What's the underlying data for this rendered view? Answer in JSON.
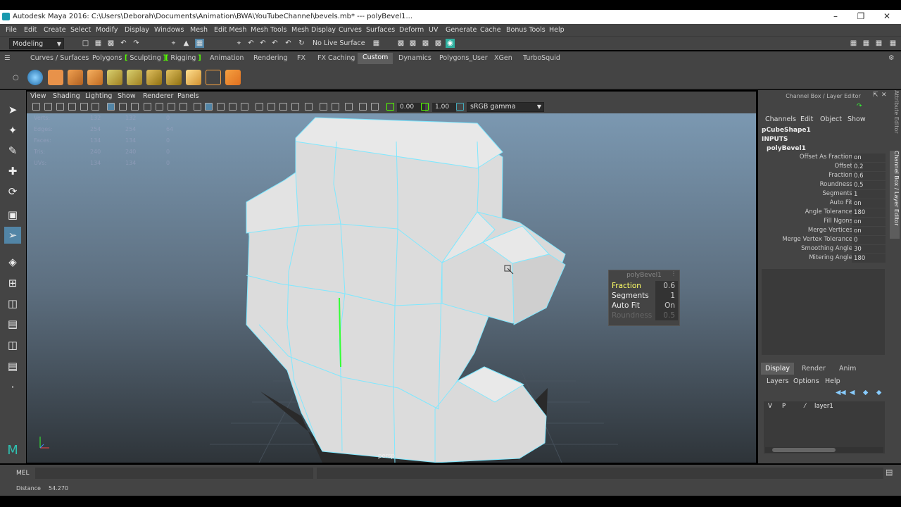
{
  "titlebar": {
    "title": "Autodesk Maya 2016: C:\\Users\\Deborah\\Documents\\Animation\\BWA\\YouTubeChannel\\bevels.mb*   ---   polyBevel1..."
  },
  "menubar": {
    "items": [
      "File",
      "Edit",
      "Create",
      "Select",
      "Modify",
      "Display",
      "Windows",
      "Mesh",
      "Edit Mesh",
      "Mesh Tools",
      "Mesh Display",
      "Curves",
      "Surfaces",
      "Deform",
      "UV",
      "Generate",
      "Cache",
      "Bonus Tools",
      "Help"
    ]
  },
  "statusline": {
    "mode": "Modeling",
    "live_surface": "No Live Surface"
  },
  "shelf_tabs": [
    "Curves / Surfaces",
    "Polygons",
    "Sculpting",
    "Rigging",
    "Animation",
    "Rendering",
    "FX",
    "FX Caching",
    "Custom",
    "Dynamics",
    "Polygons_User",
    "XGen",
    "TurboSquid"
  ],
  "active_shelf_tab": "Custom",
  "panel_menu": [
    "View",
    "Shading",
    "Lighting",
    "Show",
    "Renderer",
    "Panels"
  ],
  "panel_tools": {
    "value1": "0.00",
    "value2": "1.00",
    "color_space": "sRGB gamma"
  },
  "hud": {
    "rows": [
      {
        "label": "Verts:",
        "a": "132",
        "b": "132",
        "c": "0"
      },
      {
        "label": "Edges:",
        "a": "254",
        "b": "254",
        "c": "64"
      },
      {
        "label": "Faces:",
        "a": "134",
        "b": "134",
        "c": "0"
      },
      {
        "label": "Tris:",
        "a": "240",
        "b": "240",
        "c": "0"
      },
      {
        "label": "UVs:",
        "a": "134",
        "b": "134",
        "c": "0"
      }
    ]
  },
  "viewport": {
    "camera": "persp"
  },
  "bevel_box": {
    "title": "polyBevel1",
    "rows": [
      {
        "label": "Fraction",
        "value": "0.6",
        "highlight": true
      },
      {
        "label": "Segments",
        "value": "1",
        "highlight": false
      },
      {
        "label": "Auto Fit",
        "value": "On",
        "highlight": false
      },
      {
        "label": "Roundness",
        "value": "0.5",
        "dim": true
      }
    ]
  },
  "channel_box": {
    "title": "Channel Box / Layer Editor",
    "menu": [
      "Channels",
      "Edit",
      "Object",
      "Show"
    ],
    "shape": "pCubeShape1",
    "inputs": "INPUTS",
    "node": "polyBevel1",
    "attributes": [
      {
        "name": "Offset As Fraction",
        "value": "on"
      },
      {
        "name": "Offset",
        "value": "0.2"
      },
      {
        "name": "Fraction",
        "value": "0.6"
      },
      {
        "name": "Roundness",
        "value": "0.5"
      },
      {
        "name": "Segments",
        "value": "1"
      },
      {
        "name": "Auto Fit",
        "value": "on"
      },
      {
        "name": "Angle Tolerance",
        "value": "180"
      },
      {
        "name": "Fill Ngons",
        "value": "on"
      },
      {
        "name": "Merge Vertices",
        "value": "on"
      },
      {
        "name": "Merge Vertex Tolerance",
        "value": "0"
      },
      {
        "name": "Smoothing Angle",
        "value": "30"
      },
      {
        "name": "Mitering Angle",
        "value": "180"
      }
    ]
  },
  "layer_editor": {
    "tabs": [
      "Display",
      "Render",
      "Anim"
    ],
    "active_tab": "Display",
    "menu": [
      "Layers",
      "Options",
      "Help"
    ],
    "layer": {
      "v": "V",
      "p": "P",
      "name": "layer1"
    }
  },
  "side_tabs": [
    "Attribute Editor",
    "Channel Box / Layer Editor"
  ],
  "cmdline": {
    "label": "MEL"
  },
  "helpline": {
    "label": "Distance",
    "value": "54.270"
  },
  "colors": {
    "accent": "#5285a6",
    "shelf_active": "#5d5d5d",
    "wire": "#7fe8ff",
    "highlight_text": "#ffff66"
  }
}
